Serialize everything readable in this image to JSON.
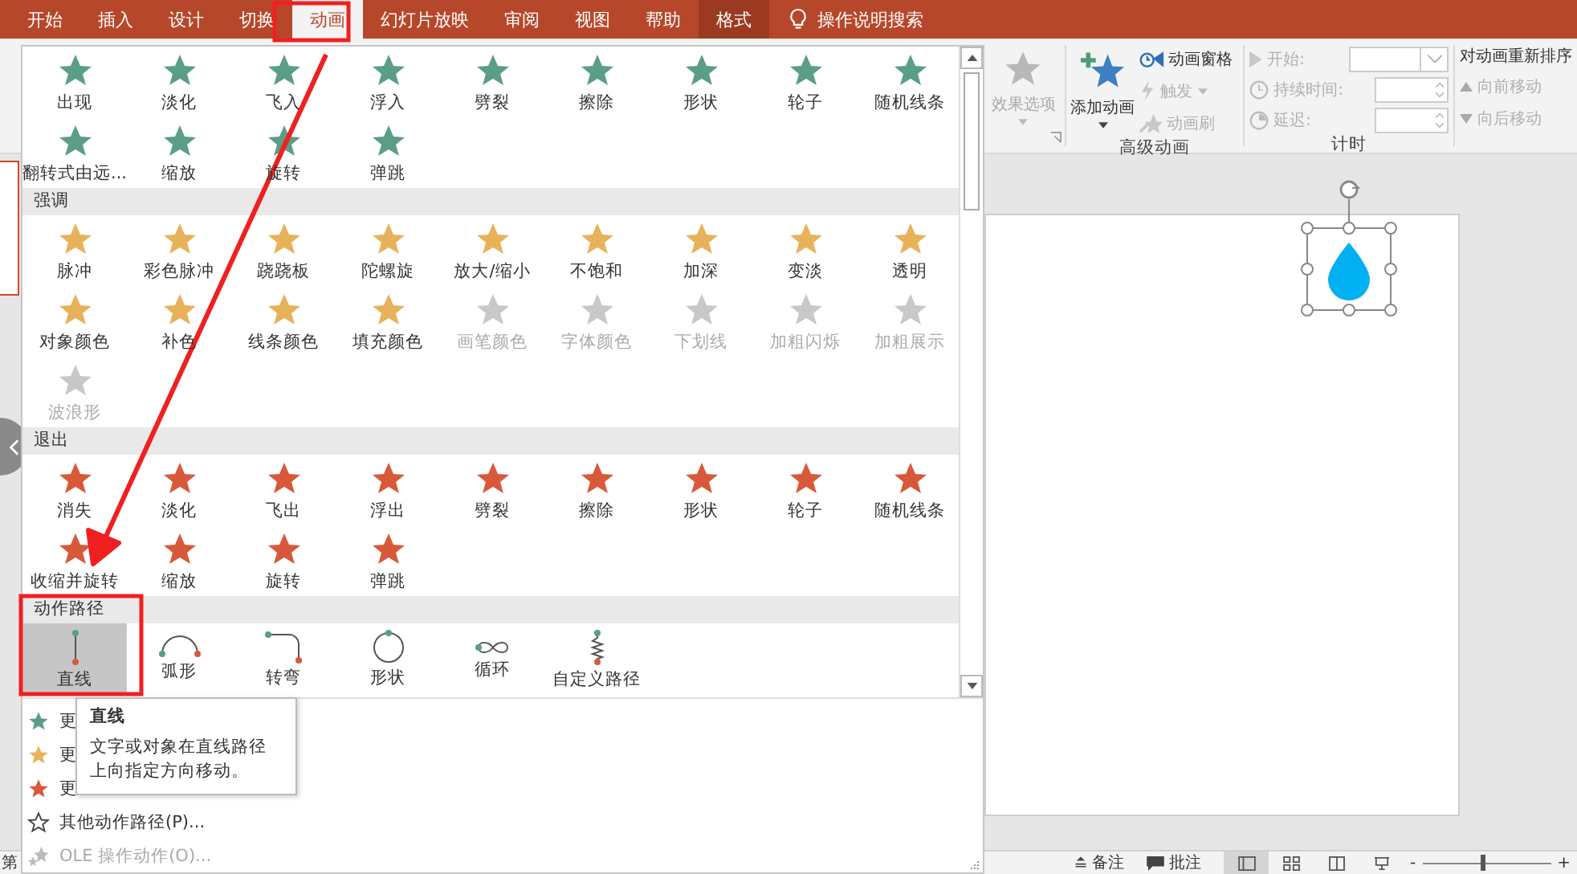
{
  "tabs": [
    {
      "label": "开始",
      "selected": false,
      "contextual": false
    },
    {
      "label": "插入",
      "selected": false,
      "contextual": false
    },
    {
      "label": "设计",
      "selected": false,
      "contextual": false
    },
    {
      "label": "切换",
      "selected": false,
      "contextual": false
    },
    {
      "label": "动画",
      "selected": true,
      "contextual": false
    },
    {
      "label": "幻灯片放映",
      "selected": false,
      "contextual": false
    },
    {
      "label": "审阅",
      "selected": false,
      "contextual": false
    },
    {
      "label": "视图",
      "selected": false,
      "contextual": false
    },
    {
      "label": "帮助",
      "selected": false,
      "contextual": false
    },
    {
      "label": "格式",
      "selected": false,
      "contextual": true
    }
  ],
  "search": {
    "label": "操作说明搜索"
  },
  "ribbon": {
    "effect_options": {
      "label": "效果选项",
      "disabled": true
    },
    "advanced": {
      "add_animation": "添加动画",
      "group_label": "高级动画",
      "items": [
        {
          "kind": "pane",
          "label": "动画窗格",
          "disabled": false,
          "dropdown": false
        },
        {
          "kind": "trigger",
          "label": "触发",
          "disabled": true,
          "dropdown": true
        },
        {
          "kind": "brush",
          "label": "动画刷",
          "disabled": true,
          "dropdown": false
        }
      ]
    },
    "timing": {
      "group_label": "计时",
      "fields": [
        {
          "kind": "combo",
          "label": "开始:",
          "disabled": true
        },
        {
          "kind": "spin",
          "label": "持续时间:",
          "disabled": true
        },
        {
          "kind": "spin",
          "label": "延迟:",
          "disabled": true
        }
      ]
    },
    "reorder": {
      "title": "对动画重新排序",
      "buttons": [
        {
          "kind": "up",
          "label": "向前移动",
          "disabled": true
        },
        {
          "kind": "down",
          "label": "向后移动",
          "disabled": true
        }
      ]
    }
  },
  "gallery": {
    "sections": [
      {
        "kind": "effect",
        "color": "#5a9e86",
        "items": [
          {
            "label": "出现",
            "selected": false,
            "disabled": false
          },
          {
            "label": "淡化",
            "selected": false,
            "disabled": false
          },
          {
            "label": "飞入",
            "selected": false,
            "disabled": false
          },
          {
            "label": "浮入",
            "selected": false,
            "disabled": false
          },
          {
            "label": "劈裂",
            "selected": false,
            "disabled": false
          },
          {
            "label": "擦除",
            "selected": false,
            "disabled": false
          },
          {
            "label": "形状",
            "selected": false,
            "disabled": false
          },
          {
            "label": "轮子",
            "selected": false,
            "disabled": false
          },
          {
            "label": "随机线条",
            "selected": false,
            "disabled": false
          },
          {
            "label": "翻转式由远...",
            "selected": false,
            "disabled": false
          },
          {
            "label": "缩放",
            "selected": false,
            "disabled": false
          },
          {
            "label": "旋转",
            "selected": false,
            "disabled": false
          },
          {
            "label": "弹跳",
            "selected": false,
            "disabled": false
          }
        ]
      },
      {
        "kind": "effect",
        "title": "强调",
        "color": "#e8b25a",
        "items": [
          {
            "label": "脉冲",
            "selected": false,
            "disabled": false
          },
          {
            "label": "彩色脉冲",
            "selected": false,
            "disabled": false
          },
          {
            "label": "跷跷板",
            "selected": false,
            "disabled": false
          },
          {
            "label": "陀螺旋",
            "selected": false,
            "disabled": false
          },
          {
            "label": "放大/缩小",
            "selected": false,
            "disabled": false
          },
          {
            "label": "不饱和",
            "selected": false,
            "disabled": false
          },
          {
            "label": "加深",
            "selected": false,
            "disabled": false
          },
          {
            "label": "变淡",
            "selected": false,
            "disabled": false
          },
          {
            "label": "透明",
            "selected": false,
            "disabled": false
          },
          {
            "label": "对象颜色",
            "selected": false,
            "disabled": false
          },
          {
            "label": "补色",
            "selected": false,
            "disabled": false
          },
          {
            "label": "线条颜色",
            "selected": false,
            "disabled": false
          },
          {
            "label": "填充颜色",
            "selected": false,
            "disabled": false
          },
          {
            "label": "画笔颜色",
            "selected": false,
            "disabled": true
          },
          {
            "label": "字体颜色",
            "selected": false,
            "disabled": true
          },
          {
            "label": "下划线",
            "selected": false,
            "disabled": true
          },
          {
            "label": "加粗闪烁",
            "selected": false,
            "disabled": true
          },
          {
            "label": "加粗展示",
            "selected": false,
            "disabled": true
          },
          {
            "label": "波浪形",
            "selected": false,
            "disabled": true
          }
        ]
      },
      {
        "kind": "effect",
        "title": "退出",
        "color": "#d8593a",
        "items": [
          {
            "label": "消失",
            "selected": false,
            "disabled": false
          },
          {
            "label": "淡化",
            "selected": false,
            "disabled": false
          },
          {
            "label": "飞出",
            "selected": false,
            "disabled": false
          },
          {
            "label": "浮出",
            "selected": false,
            "disabled": false
          },
          {
            "label": "劈裂",
            "selected": false,
            "disabled": false
          },
          {
            "label": "擦除",
            "selected": false,
            "disabled": false
          },
          {
            "label": "形状",
            "selected": false,
            "disabled": false
          },
          {
            "label": "轮子",
            "selected": false,
            "disabled": false
          },
          {
            "label": "随机线条",
            "selected": false,
            "disabled": false
          },
          {
            "label": "收缩并旋转",
            "selected": false,
            "disabled": false
          },
          {
            "label": "缩放",
            "selected": false,
            "disabled": false
          },
          {
            "label": "旋转",
            "selected": false,
            "disabled": false
          },
          {
            "label": "弹跳",
            "selected": false,
            "disabled": false
          }
        ]
      },
      {
        "kind": "path",
        "title": "动作路径",
        "color": "#5a9e86",
        "items": [
          {
            "kind": "line",
            "label": "直线",
            "selected": true,
            "disabled": false
          },
          {
            "kind": "arc",
            "label": "弧形",
            "selected": false,
            "disabled": false
          },
          {
            "kind": "turn",
            "label": "转弯",
            "selected": false,
            "disabled": false
          },
          {
            "kind": "circle",
            "label": "形状",
            "selected": false,
            "disabled": false
          },
          {
            "kind": "loop",
            "label": "循环",
            "selected": false,
            "disabled": false
          },
          {
            "kind": "custom",
            "label": "自定义路径",
            "selected": false,
            "disabled": false
          }
        ]
      }
    ],
    "menu": [
      {
        "kind": "star",
        "label": "更",
        "color": "#5a9e86",
        "disabled": false
      },
      {
        "kind": "star",
        "label": "更",
        "color": "#e8b25a",
        "disabled": false
      },
      {
        "kind": "star",
        "label": "更",
        "color": "#d8593a",
        "disabled": false
      },
      {
        "kind": "outline",
        "label": "其他动作路径(P)...",
        "disabled": false
      },
      {
        "kind": "ole",
        "label": "OLE 操作动作(O)...",
        "disabled": true
      }
    ],
    "tooltip": {
      "title": "直线",
      "text": "文字或对象在直线路径上向指定方向移动。"
    }
  },
  "status_bar": {
    "left_text": "第",
    "notes": "备注",
    "comments": "批注",
    "views": [
      {
        "kind": "normal",
        "selected": true
      },
      {
        "kind": "sorter",
        "selected": false
      },
      {
        "kind": "reading",
        "selected": false
      },
      {
        "kind": "show",
        "selected": false
      }
    ],
    "zoom_out": "-",
    "zoom_in": "+",
    "zoom": {
      "level": 0.45
    }
  }
}
